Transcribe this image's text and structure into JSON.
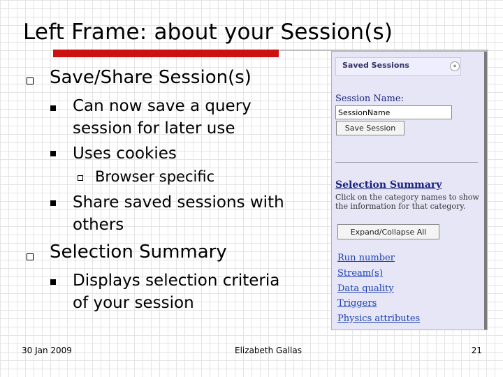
{
  "slide": {
    "title": "Left Frame: about your Session(s)",
    "bullets": [
      {
        "text": "Save/Share Session(s)",
        "subs": [
          {
            "lines": [
              "Can now save a query",
              "session for later use"
            ]
          },
          {
            "lines": [
              "Uses cookies"
            ]
          },
          {
            "lines": [
              "Browser specific"
            ]
          },
          {
            "lines": [
              "Share saved sessions with",
              "others"
            ]
          }
        ]
      },
      {
        "text": "Selection Summary",
        "subs": [
          {
            "lines": [
              "Displays selection criteria",
              "of your session"
            ]
          }
        ]
      }
    ]
  },
  "panel": {
    "saved_header": "Saved Sessions",
    "collapse_glyph": "«",
    "session_name_label": "Session Name:",
    "session_name_value": "SessionName",
    "save_button": "Save Session",
    "summary_title": "Selection Summary",
    "summary_desc": "Click on the category names to show the information for that category.",
    "expand_button": "Expand/Collapse All",
    "categories": [
      "Run number",
      "Stream(s)",
      "Data quality",
      "Triggers",
      "Physics attributes"
    ]
  },
  "footer": {
    "date": "30 Jan 2009",
    "author": "Elizabeth Gallas",
    "page": "21"
  },
  "colors": {
    "accent_red": "#cc1111",
    "panel_bg": "#e6e6f7",
    "link_blue": "#1a3fb0",
    "heading_navy": "#1a237e"
  }
}
